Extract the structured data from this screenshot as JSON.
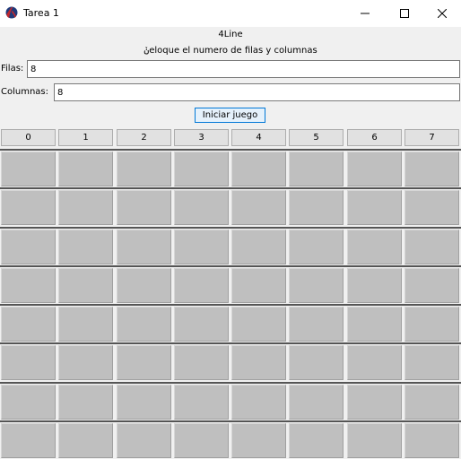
{
  "window": {
    "title": "Tarea 1",
    "minimize_symbol": "—",
    "maximize_symbol": "☐",
    "close_symbol": "✕"
  },
  "app": {
    "title": "4Line",
    "instruction": "ݩeloque el numero de filas y columnas"
  },
  "form": {
    "rows_label": "Filas:",
    "rows_value": "8",
    "cols_label": "Columnas:",
    "cols_value": "8",
    "start_button": "Iniciar juego"
  },
  "board": {
    "columns": [
      "0",
      "1",
      "2",
      "3",
      "4",
      "5",
      "6",
      "7"
    ],
    "rows": 8,
    "cell_color": "#bfbfbf",
    "separator_color": "#555555"
  },
  "icons": {
    "app": "racket-logo-icon"
  }
}
